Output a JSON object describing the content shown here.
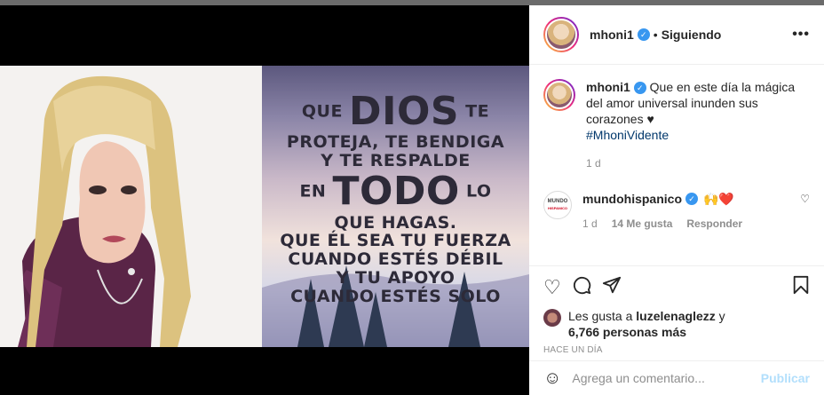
{
  "post": {
    "username": "mhoni1",
    "follow_status": "Siguiendo",
    "more_label": "•••",
    "caption_user": "mhoni1",
    "caption_line1": "Que en este día la mágica",
    "caption_line2": "del amor universal inunden sus",
    "caption_line3": "corazones ♥",
    "hashtag": "#MhoniVidente",
    "caption_time": "1 d"
  },
  "poster": {
    "l1_a": "QUE",
    "l1_big": "DIOS",
    "l1_b": "TE",
    "l2": "PROTEJA, TE BENDIGA",
    "l3": "Y TE RESPALDE",
    "l4_a": "EN",
    "l4_big": "TODO",
    "l4_b": "LO",
    "l5": "QUE HAGAS.",
    "l6": "QUE ÉL SEA TU FUERZA",
    "l7": "CUANDO ESTÉS DÉBIL",
    "l8": "Y TU APOYO",
    "l9": "CUANDO ESTÉS SOLO"
  },
  "comment": {
    "user": "mundohispanico",
    "logo_top": "MUNDO",
    "logo_bottom": "HISPANICO",
    "text": "🙌❤️",
    "time": "1 d",
    "likes": "14 Me gusta",
    "reply": "Responder"
  },
  "likes_text_prefix": "Les gusta a ",
  "likes_user": "luzelenaglezz",
  "likes_suffix": " y",
  "likes_count": "6,766 personas más",
  "timeago": "HACE UN DÍA",
  "add_comment": {
    "placeholder": "Agrega un comentario...",
    "post": "Publicar"
  },
  "icons": {
    "verified": "verified-check-icon",
    "heart": "heart-icon",
    "comment": "comment-bubble-icon",
    "share": "paper-plane-icon",
    "bookmark": "bookmark-icon",
    "emoji": "emoji-icon"
  },
  "colors": {
    "verified": "#3897f0",
    "link": "#00376b",
    "publish_disabled": "#b2dffc"
  }
}
